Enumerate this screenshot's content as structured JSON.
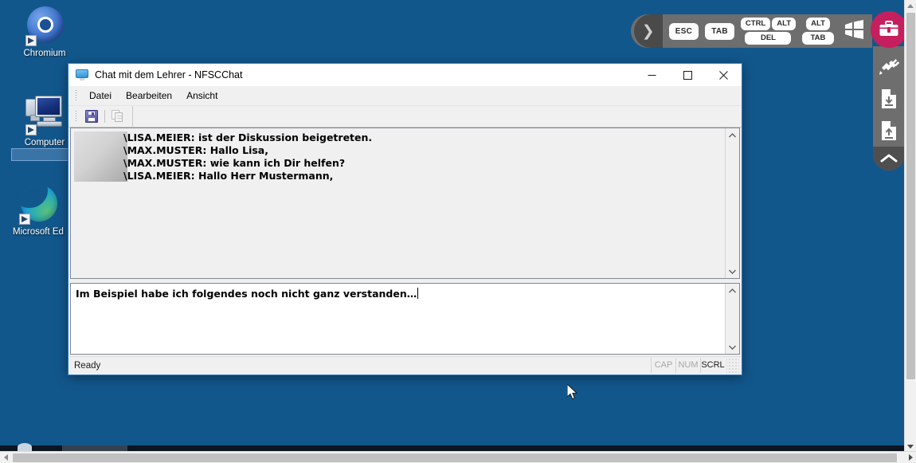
{
  "desktop": {
    "icons": [
      {
        "label": "Chromium",
        "icon": "chromium-icon",
        "selected": false
      },
      {
        "label": "Computer",
        "icon": "computer-icon",
        "selected": true
      },
      {
        "label": "Microsoft Ed",
        "icon": "microsoft-edge-icon",
        "selected": false
      }
    ]
  },
  "window": {
    "title": "Chat mit dem Lehrer - NFSCChat",
    "title_icon": "chat-monitor-icon",
    "controls": {
      "minimize": "minimize-button",
      "maximize": "maximize-button",
      "close": "close-button"
    },
    "menu": [
      {
        "label": "Datei"
      },
      {
        "label": "Bearbeiten"
      },
      {
        "label": "Ansicht"
      }
    ],
    "toolbar": [
      {
        "name": "save-icon",
        "label": "Speichern",
        "enabled": true
      },
      {
        "name": "copy-icon",
        "label": "Kopieren",
        "enabled": false
      }
    ],
    "chat_log": {
      "lines": [
        "\\LISA.MEIER: ist der Diskussion beigetreten.",
        "\\MAX.MUSTER: Hallo Lisa,",
        "\\MAX.MUSTER: wie kann ich Dir helfen?",
        "\\LISA.MEIER: Hallo Herr Mustermann,"
      ]
    },
    "input": {
      "value": "Im Beispiel habe ich folgendes noch nicht ganz verstanden…",
      "placeholder": ""
    },
    "status": {
      "message": "Ready",
      "indicators": [
        {
          "label": "CAP",
          "active": false
        },
        {
          "label": "NUM",
          "active": false
        },
        {
          "label": "SCRL",
          "active": true
        }
      ]
    }
  },
  "devbar": {
    "handle": "❯",
    "keys": [
      {
        "label": "ESC"
      },
      {
        "label": "TAB"
      }
    ],
    "combos": [
      {
        "top": [
          "CTRL",
          "ALT"
        ],
        "bottom": "DEL"
      },
      {
        "top": [
          "ALT"
        ],
        "bottom": "TAB"
      }
    ],
    "windows_key": "windows-logo-key"
  },
  "sidedock": {
    "toolbox": "toolbox-button",
    "items": [
      {
        "name": "plug-connection-icon"
      },
      {
        "name": "file-download-icon"
      },
      {
        "name": "file-upload-icon"
      }
    ],
    "collapse": "collapse-chevron-icon"
  },
  "colors": {
    "desktop_blue": "#12578c",
    "window_border": "#2a7ac4",
    "accent_magenta": "#c51f5d",
    "devbar_gray": "#6e6e6e",
    "scrollbar_thumb": "#c1c1c1"
  }
}
